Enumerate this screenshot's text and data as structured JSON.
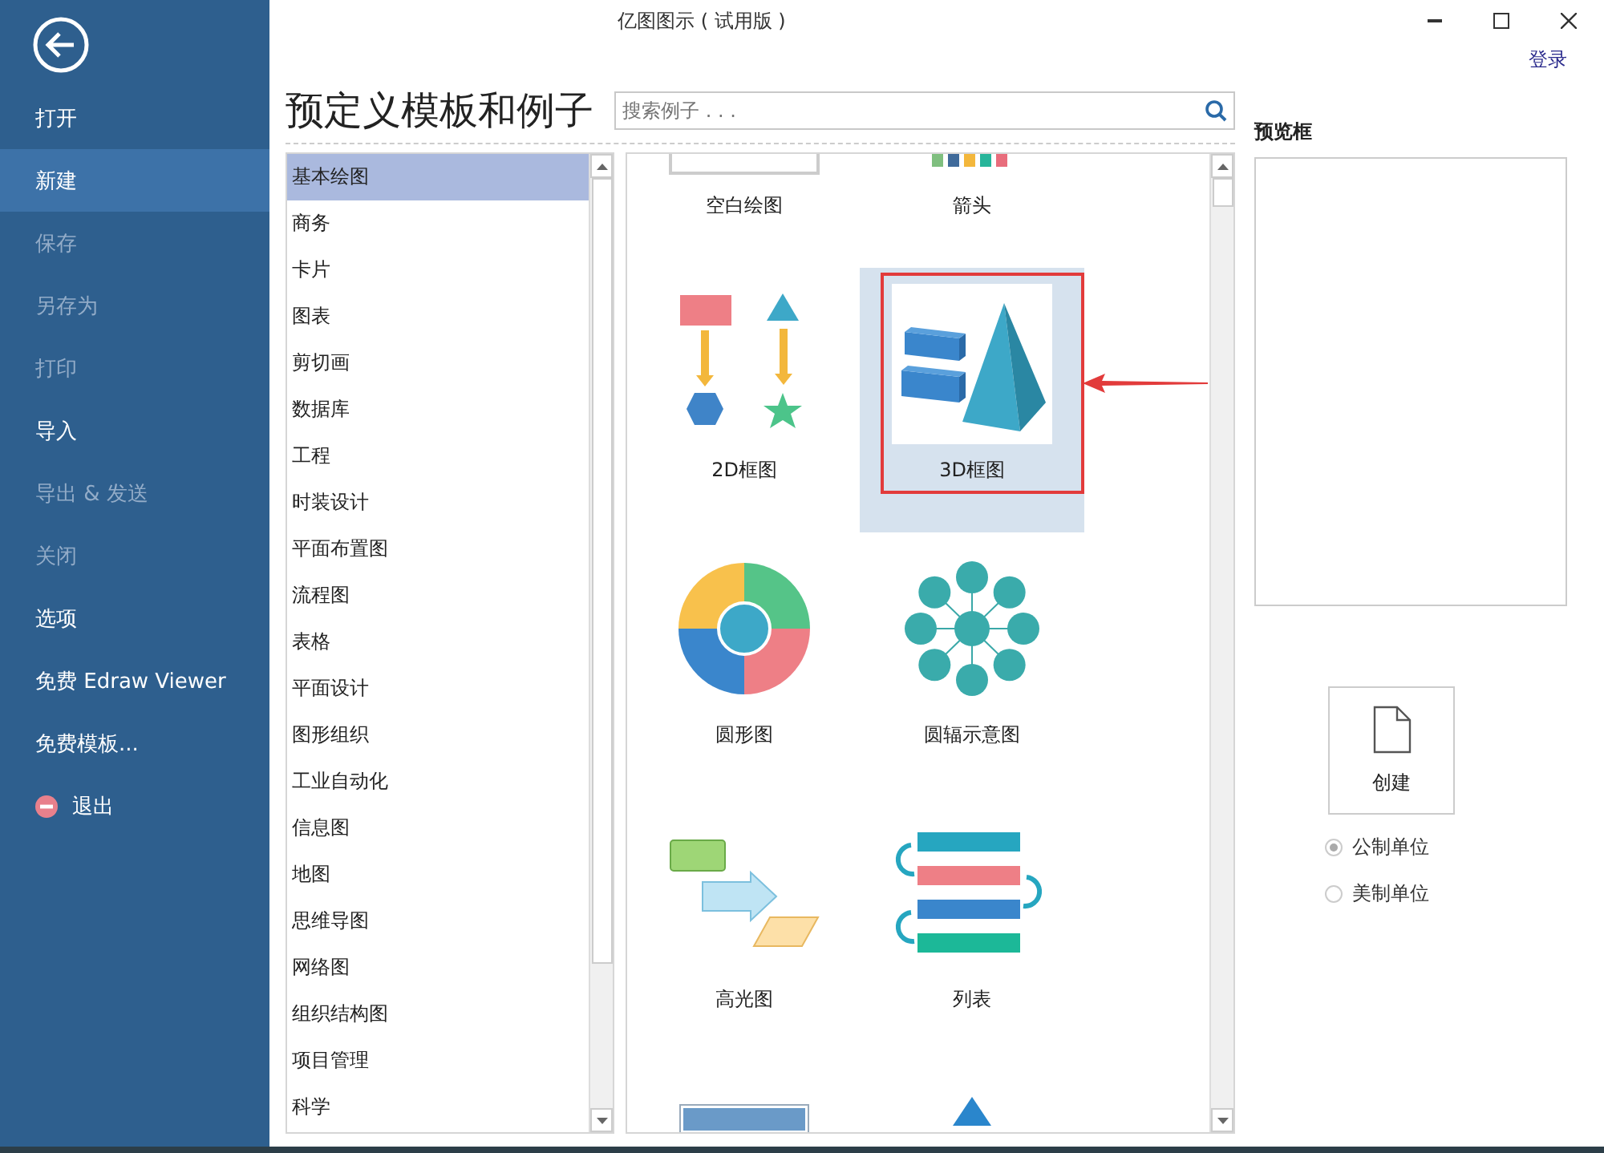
{
  "window": {
    "title": "亿图图示 ( 试用版 )"
  },
  "sidebar": {
    "items": [
      {
        "label": "打开",
        "selected": false,
        "disabled": false
      },
      {
        "label": "新建",
        "selected": true,
        "disabled": false
      },
      {
        "label": "保存",
        "selected": false,
        "disabled": true
      },
      {
        "label": "另存为",
        "selected": false,
        "disabled": true
      },
      {
        "label": "打印",
        "selected": false,
        "disabled": true
      },
      {
        "label": "导入",
        "selected": false,
        "disabled": false
      },
      {
        "label": "导出 & 发送",
        "selected": false,
        "disabled": true
      },
      {
        "label": "关闭",
        "selected": false,
        "disabled": true
      },
      {
        "label": "选项",
        "selected": false,
        "disabled": false
      },
      {
        "label": "免费 Edraw Viewer",
        "selected": false,
        "disabled": false
      },
      {
        "label": "免费模板...",
        "selected": false,
        "disabled": false
      },
      {
        "label": "退出",
        "selected": false,
        "disabled": false,
        "kind": "exit"
      }
    ]
  },
  "login": "登录",
  "heading": "预定义模板和例子",
  "search": {
    "placeholder": "搜索例子 . . ."
  },
  "categories": [
    {
      "label": "基本绘图",
      "selected": true
    },
    {
      "label": "商务",
      "selected": false
    },
    {
      "label": "卡片",
      "selected": false
    },
    {
      "label": "图表",
      "selected": false
    },
    {
      "label": "剪切画",
      "selected": false
    },
    {
      "label": "数据库",
      "selected": false
    },
    {
      "label": "工程",
      "selected": false
    },
    {
      "label": "时装设计",
      "selected": false
    },
    {
      "label": "平面布置图",
      "selected": false
    },
    {
      "label": "流程图",
      "selected": false
    },
    {
      "label": "表格",
      "selected": false
    },
    {
      "label": "平面设计",
      "selected": false
    },
    {
      "label": "图形组织",
      "selected": false
    },
    {
      "label": "工业自动化",
      "selected": false
    },
    {
      "label": "信息图",
      "selected": false
    },
    {
      "label": "地图",
      "selected": false
    },
    {
      "label": "思维导图",
      "selected": false
    },
    {
      "label": "网络图",
      "selected": false
    },
    {
      "label": "组织结构图",
      "selected": false
    },
    {
      "label": "项目管理",
      "selected": false
    },
    {
      "label": "科学",
      "selected": false
    }
  ],
  "templates": [
    {
      "kind": "blank",
      "label": "空白绘图",
      "selected": false
    },
    {
      "kind": "arrows",
      "label": "箭头",
      "selected": false
    },
    {
      "kind": "flat",
      "label": "2D框图",
      "selected": false
    },
    {
      "kind": "solid",
      "label": "3D框图",
      "selected": true,
      "annotated": true
    },
    {
      "kind": "circle",
      "label": "圆形图",
      "selected": false
    },
    {
      "kind": "radial",
      "label": "圆辐示意图",
      "selected": false
    },
    {
      "kind": "highlight",
      "label": "高光图",
      "selected": false
    },
    {
      "kind": "list",
      "label": "列表",
      "selected": false
    },
    {
      "kind": "block",
      "selected": false
    },
    {
      "kind": "triangle",
      "selected": false
    }
  ],
  "preview": {
    "label": "预览框"
  },
  "create_button": "创建",
  "units": [
    {
      "label": "公制单位",
      "selected": true
    },
    {
      "label": "美制单位",
      "selected": false
    }
  ]
}
